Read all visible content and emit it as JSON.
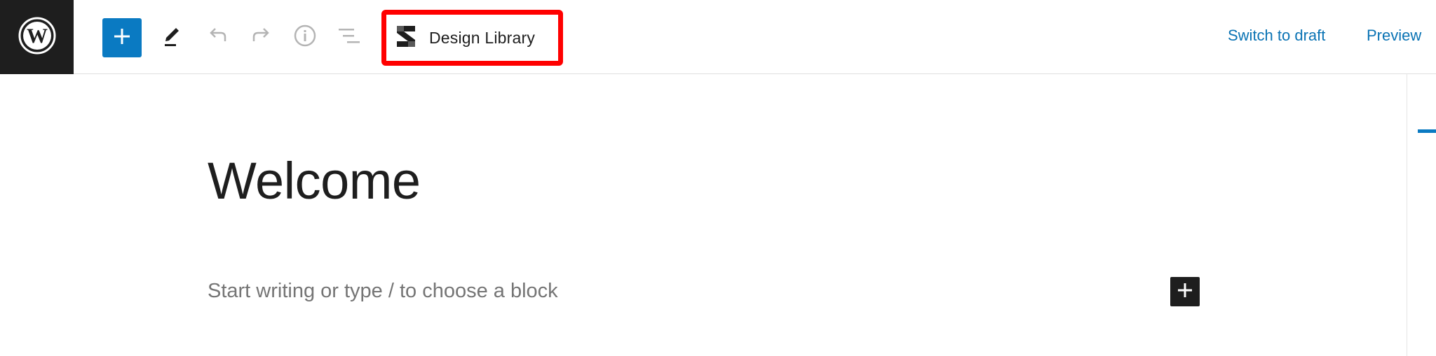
{
  "toolbar": {
    "design_library_label": "Design Library",
    "switch_to_draft_label": "Switch to draft",
    "preview_label": "Preview"
  },
  "editor": {
    "post_title": "Welcome",
    "block_placeholder": "Start writing or type / to choose a block"
  },
  "colors": {
    "accent": "#0a7ac2",
    "link": "#0a73b4",
    "dark": "#1e1e1e",
    "highlight": "#ff0000"
  },
  "icons": {
    "logo": "wordpress-logo-icon",
    "add": "plus-icon",
    "edit": "pencil-icon",
    "undo": "undo-icon",
    "redo": "redo-icon",
    "info": "info-icon",
    "outline": "list-view-icon",
    "design_library": "stackable-logo-icon"
  }
}
